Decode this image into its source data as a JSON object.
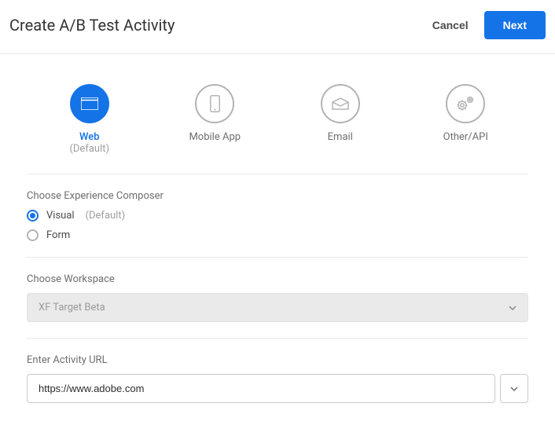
{
  "header": {
    "title": "Create A/B Test Activity",
    "cancel": "Cancel",
    "next": "Next"
  },
  "channels": [
    {
      "label": "Web",
      "sub": "(Default)",
      "selected": true,
      "icon": "web"
    },
    {
      "label": "Mobile App",
      "sub": "",
      "selected": false,
      "icon": "mobile"
    },
    {
      "label": "Email",
      "sub": "",
      "selected": false,
      "icon": "email"
    },
    {
      "label": "Other/API",
      "sub": "",
      "selected": false,
      "icon": "gears"
    }
  ],
  "composer": {
    "label": "Choose Experience Composer",
    "options": [
      {
        "label": "Visual",
        "sub": "(Default)",
        "checked": true
      },
      {
        "label": "Form",
        "sub": "",
        "checked": false
      }
    ]
  },
  "workspace": {
    "label": "Choose Workspace",
    "value": "XF Target Beta"
  },
  "url": {
    "label": "Enter Activity URL",
    "value": "https://www.adobe.com"
  }
}
